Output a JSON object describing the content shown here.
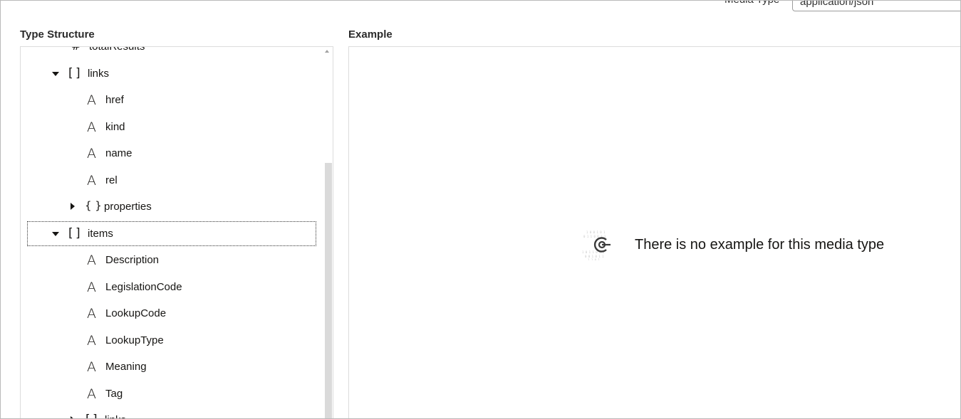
{
  "header": {
    "media_type_label": "Media Type",
    "media_type_value": "application/json"
  },
  "type_structure": {
    "title": "Type Structure",
    "nodes": [
      {
        "label": "totalResults",
        "icon": "#",
        "icon_name": "number-icon",
        "toggle": null
      },
      {
        "label": "links",
        "icon": "[ ]",
        "icon_name": "array-icon",
        "toggle": "expanded"
      },
      {
        "label": "href",
        "icon": "A",
        "icon_name": "string-icon",
        "toggle": null
      },
      {
        "label": "kind",
        "icon": "A",
        "icon_name": "string-icon",
        "toggle": null
      },
      {
        "label": "name",
        "icon": "A",
        "icon_name": "string-icon",
        "toggle": null
      },
      {
        "label": "rel",
        "icon": "A",
        "icon_name": "string-icon",
        "toggle": null
      },
      {
        "label": "properties",
        "icon": "{ }",
        "icon_name": "object-icon",
        "toggle": "collapsed"
      },
      {
        "label": "items",
        "icon": "[ ]",
        "icon_name": "array-icon",
        "toggle": "expanded",
        "focused": true
      },
      {
        "label": "Description",
        "icon": "A",
        "icon_name": "string-icon",
        "toggle": null
      },
      {
        "label": "LegislationCode",
        "icon": "A",
        "icon_name": "string-icon",
        "toggle": null
      },
      {
        "label": "LookupCode",
        "icon": "A",
        "icon_name": "string-icon",
        "toggle": null
      },
      {
        "label": "LookupType",
        "icon": "A",
        "icon_name": "string-icon",
        "toggle": null
      },
      {
        "label": "Meaning",
        "icon": "A",
        "icon_name": "string-icon",
        "toggle": null
      },
      {
        "label": "Tag",
        "icon": "A",
        "icon_name": "string-icon",
        "toggle": null
      },
      {
        "label": "links",
        "icon": "[ ]",
        "icon_name": "array-icon",
        "toggle": "collapsed"
      }
    ]
  },
  "example": {
    "title": "Example",
    "empty_message": "There is no example for this media type",
    "empty_icon": "no-example-icon"
  }
}
